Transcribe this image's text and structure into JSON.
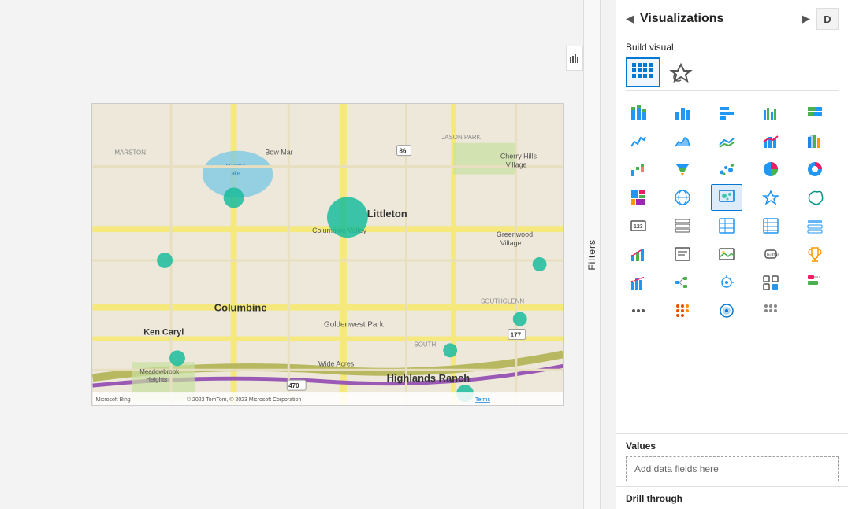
{
  "panel": {
    "title": "Visualizations",
    "build_visual_label": "Build visual",
    "nav_left": "◀",
    "nav_right": "▶",
    "collapse_left": "◀",
    "stats_icon": "📊"
  },
  "filters": {
    "label": "Filters"
  },
  "values_section": {
    "label": "Values",
    "add_data_fields_placeholder": "Add data fields here"
  },
  "drill_through": {
    "label": "Drill through"
  },
  "viz_icons": [
    {
      "name": "stacked-bar",
      "type": "chart"
    },
    {
      "name": "bar-chart",
      "type": "chart"
    },
    {
      "name": "bar-chart-alt",
      "type": "chart"
    },
    {
      "name": "clustered-bar",
      "type": "chart"
    },
    {
      "name": "100pct-bar",
      "type": "chart"
    },
    {
      "name": "line-chart",
      "type": "chart"
    },
    {
      "name": "area-chart",
      "type": "chart"
    },
    {
      "name": "line-stacked",
      "type": "chart"
    },
    {
      "name": "combo-bar-line",
      "type": "chart"
    },
    {
      "name": "ribbon",
      "type": "chart"
    },
    {
      "name": "waterfall",
      "type": "chart"
    },
    {
      "name": "funnel",
      "type": "chart"
    },
    {
      "name": "scatter",
      "type": "chart"
    },
    {
      "name": "pie",
      "type": "chart"
    },
    {
      "name": "donut",
      "type": "chart"
    },
    {
      "name": "treemap",
      "type": "chart"
    },
    {
      "name": "map-bubble",
      "type": "map",
      "selected": true
    },
    {
      "name": "filled-map",
      "type": "map"
    },
    {
      "name": "azure-map",
      "type": "map"
    },
    {
      "name": "shape-map",
      "type": "map"
    },
    {
      "name": "card",
      "type": "kpi"
    },
    {
      "name": "multi-row-card",
      "type": "kpi"
    },
    {
      "name": "kpi",
      "type": "kpi"
    },
    {
      "name": "gauge",
      "type": "kpi"
    },
    {
      "name": "table",
      "type": "table"
    },
    {
      "name": "matrix",
      "type": "table"
    },
    {
      "name": "slicer",
      "type": "filter"
    },
    {
      "name": "text-box",
      "type": "text"
    },
    {
      "name": "image",
      "type": "media"
    },
    {
      "name": "shape",
      "type": "shape"
    },
    {
      "name": "button",
      "type": "action"
    },
    {
      "name": "bookmark",
      "type": "action"
    },
    {
      "name": "page-navigator",
      "type": "action"
    },
    {
      "name": "qr-code",
      "type": "action"
    },
    {
      "name": "decomp-tree",
      "type": "ai"
    },
    {
      "name": "key-influencers",
      "type": "ai"
    },
    {
      "name": "ellipsis",
      "type": "more"
    },
    {
      "name": "dot-grid-1",
      "type": "custom"
    },
    {
      "name": "dot-circle",
      "type": "custom"
    },
    {
      "name": "dot-grid-2",
      "type": "custom"
    }
  ],
  "map": {
    "attribution": "© 2023 TomTom, © 2023 Microsoft Corporation Terms",
    "bing_logo": "Microsoft Bing",
    "places": [
      "Littleton",
      "Columbine",
      "Ken Caryl",
      "Goldenwest Park",
      "Highlands Ranch",
      "Meadowbrook Heights",
      "Wide Acres",
      "Columbine Valley",
      "Marston Lake",
      "Bow Mar",
      "JASON PARK",
      "Cherry Hills Village",
      "Greenwood Village",
      "SOUTHGLENN",
      "SOUTH",
      "MARSTON"
    ]
  }
}
